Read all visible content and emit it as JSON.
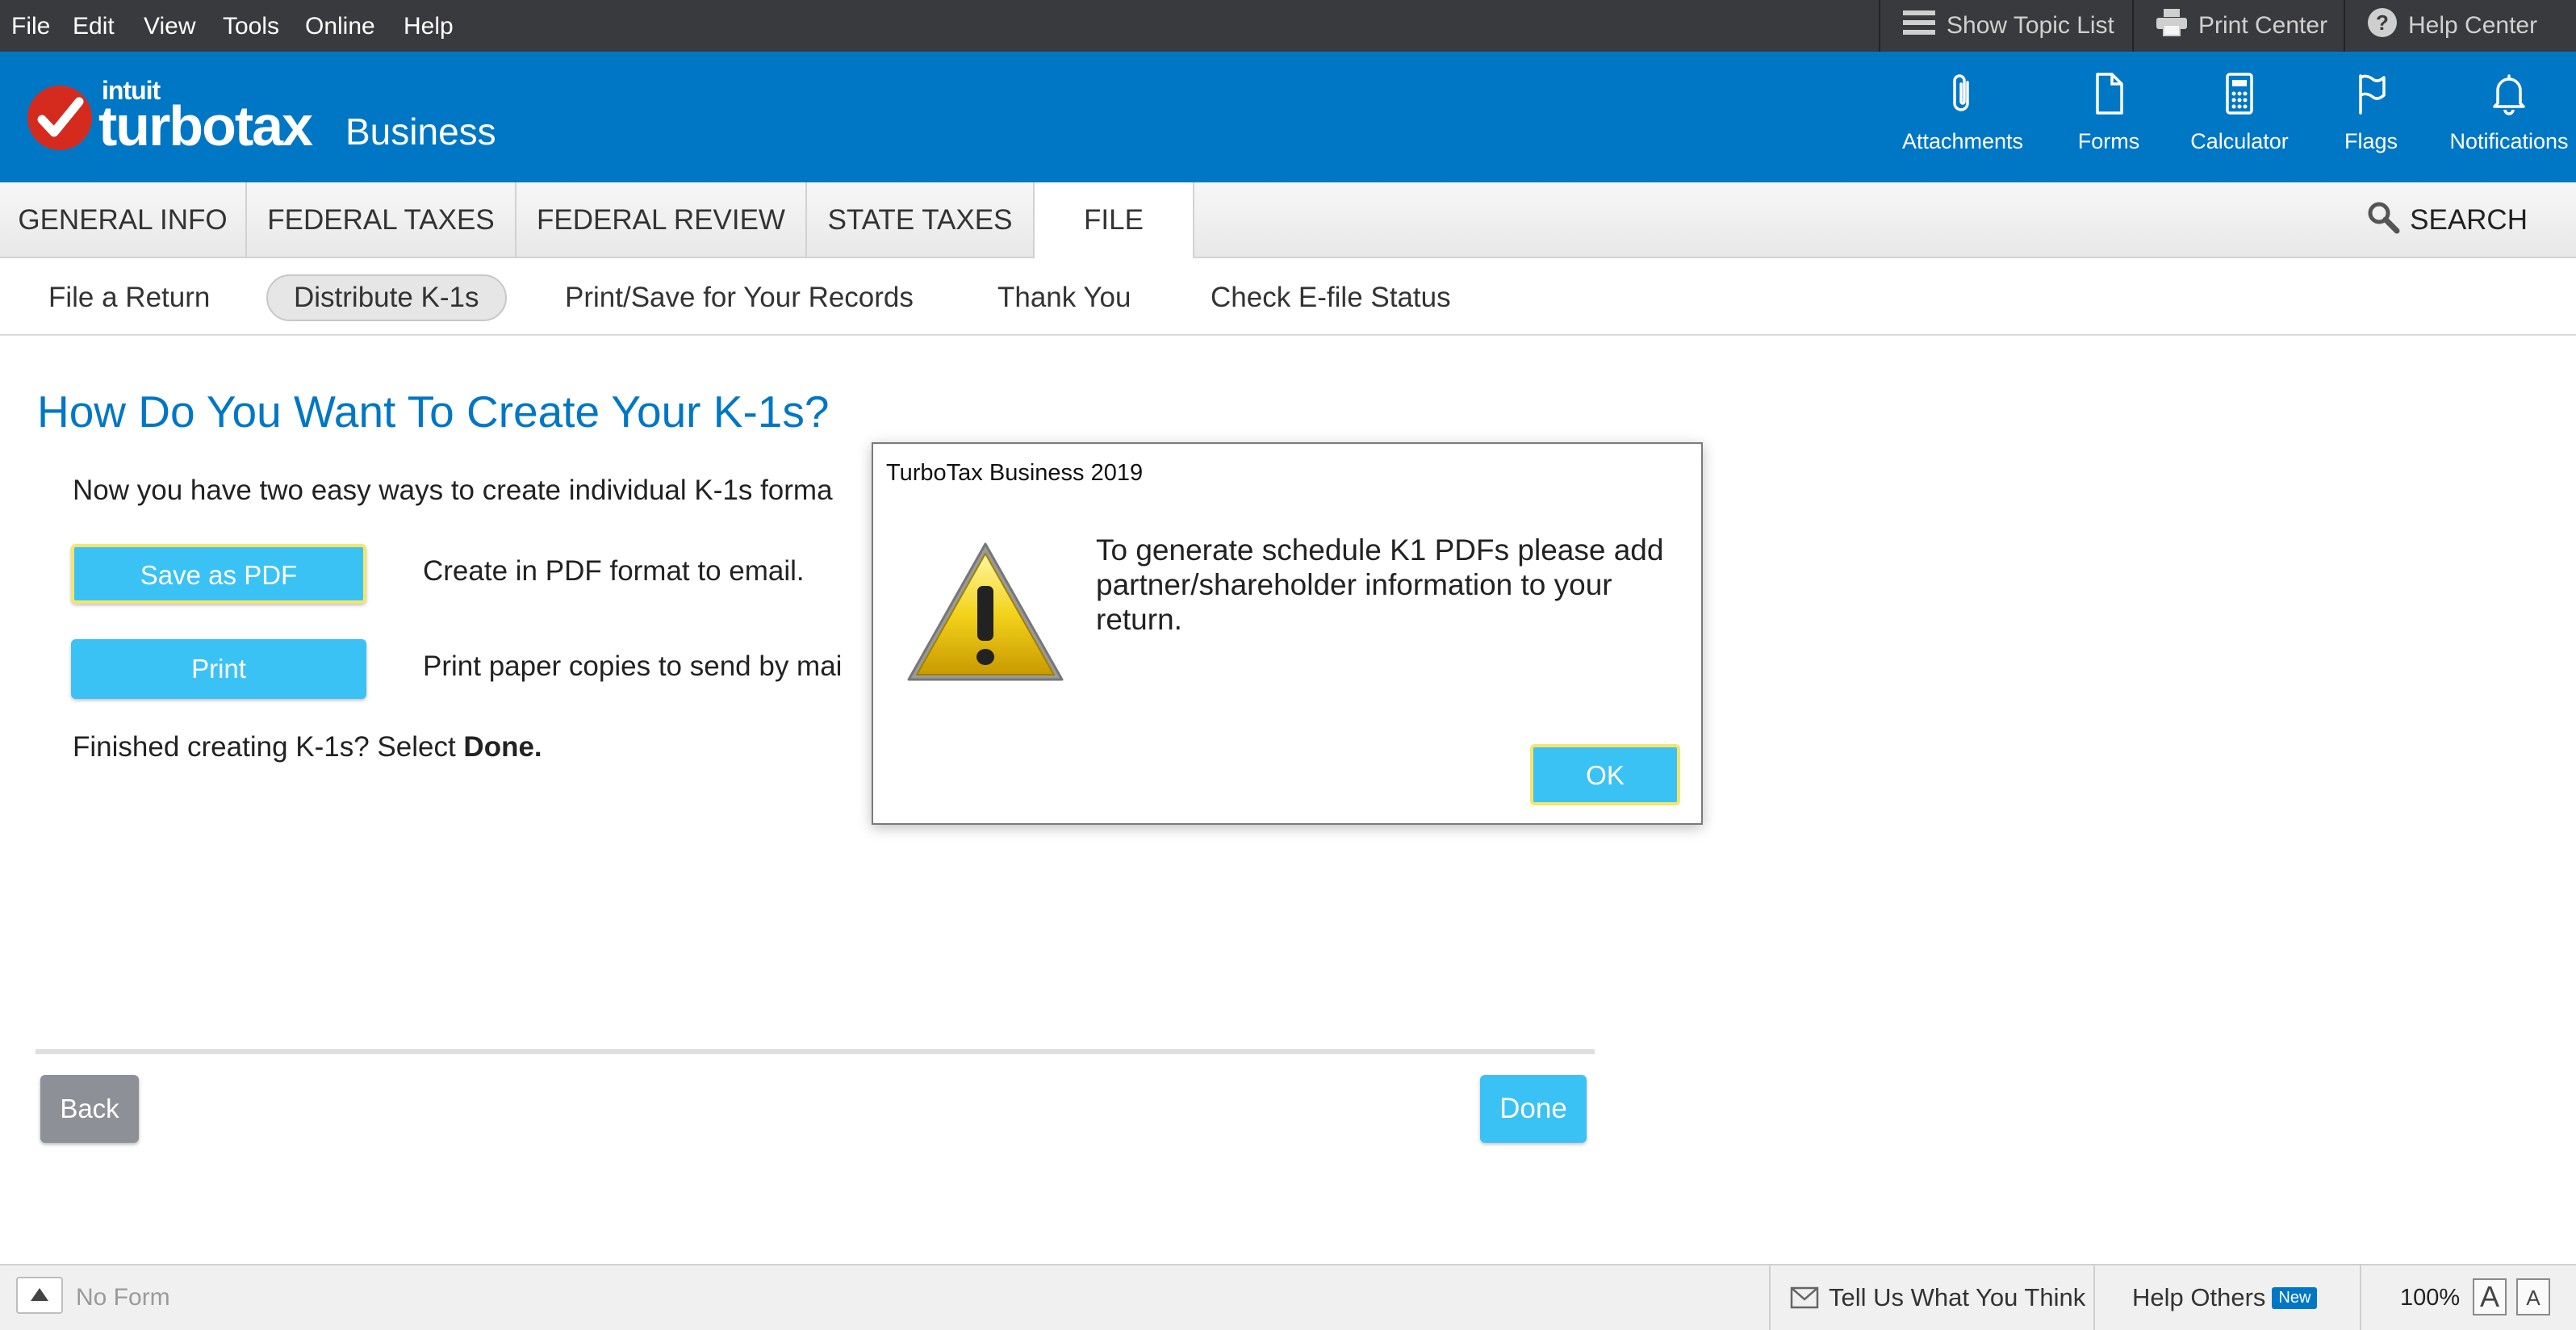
{
  "menu": {
    "items": [
      "File",
      "Edit",
      "View",
      "Tools",
      "Online",
      "Help"
    ],
    "show_topic_list": "Show Topic List",
    "print_center": "Print Center",
    "help_center": "Help Center"
  },
  "brand": {
    "intuit": "intuit",
    "turbotax": "turbotax",
    "dot": ".",
    "business": "Business",
    "color": "#0077c5"
  },
  "header_buttons": {
    "attachments": "Attachments",
    "forms": "Forms",
    "calculator": "Calculator",
    "flags": "Flags",
    "notifications": "Notifications"
  },
  "tabs": [
    "GENERAL INFO",
    "FEDERAL TAXES",
    "FEDERAL REVIEW",
    "STATE TAXES",
    "FILE"
  ],
  "active_tab": "FILE",
  "search_label": "SEARCH",
  "subtabs": [
    "File a Return",
    "Distribute K-1s",
    "Print/Save for Your Records",
    "Thank You",
    "Check E-file Status"
  ],
  "active_subtab": "Distribute K-1s",
  "content": {
    "title": "How Do You Want To Create Your K-1s?",
    "intro": "Now you have two easy ways to create individual K-1s forma",
    "save_pdf_label": "Save as PDF",
    "save_pdf_desc": "Create in PDF format to email.",
    "print_label": "Print",
    "print_desc": "Print paper copies to send by mai",
    "finished_prefix": "Finished creating K-1s? Select ",
    "finished_bold": "Done."
  },
  "nav": {
    "back": "Back",
    "done": "Done"
  },
  "dialog": {
    "title": "TurboTax Business 2019",
    "message": "To generate schedule K1 PDFs please add partner/shareholder information to your return.",
    "ok": "OK",
    "icon": "warning-icon"
  },
  "statusbar": {
    "no_form": "No Form",
    "feedback": "Tell Us What You Think",
    "help_others": "Help Others",
    "new_badge": "New",
    "zoom": "100%",
    "font_large": "A",
    "font_small": "A"
  },
  "colors": {
    "accent_blue": "#0077c5",
    "button_blue": "#3bc2f5",
    "focus_yellow": "#f5e56b",
    "menubar": "#393a3d",
    "logo_red": "#d52b1e"
  }
}
